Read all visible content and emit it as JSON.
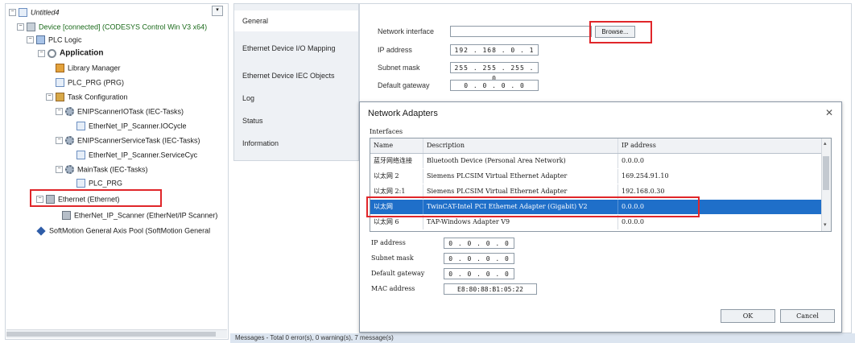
{
  "tree": {
    "items": [
      {
        "label": "Untitled4"
      },
      {
        "label": "Device [connected] (CODESYS Control Win V3 x64)"
      },
      {
        "label": "PLC Logic"
      },
      {
        "label": "Application"
      },
      {
        "label": "Library Manager"
      },
      {
        "label": "PLC_PRG (PRG)"
      },
      {
        "label": "Task Configuration"
      },
      {
        "label": "ENIPScannerIOTask (IEC-Tasks)"
      },
      {
        "label": "EtherNet_IP_Scanner.IOCycle"
      },
      {
        "label": "ENIPScannerServiceTask (IEC-Tasks)"
      },
      {
        "label": "EtherNet_IP_Scanner.ServiceCyc"
      },
      {
        "label": "MainTask (IEC-Tasks)"
      },
      {
        "label": "PLC_PRG"
      },
      {
        "label": "Ethernet (Ethernet)"
      },
      {
        "label": "EtherNet_IP_Scanner (EtherNet/IP Scanner)"
      },
      {
        "label": "SoftMotion General Axis Pool (SoftMotion General"
      }
    ]
  },
  "tabs": [
    {
      "label": "General"
    },
    {
      "label": "Ethernet Device I/O Mapping"
    },
    {
      "label": "Ethernet Device IEC Objects"
    },
    {
      "label": "Log"
    },
    {
      "label": "Status"
    },
    {
      "label": "Information"
    }
  ],
  "general": {
    "network_interface_label": "Network interface",
    "browse_label": "Browse...",
    "ip_label": "IP address",
    "ip_value": "192 . 168 . 0 . 1",
    "subnet_label": "Subnet mask",
    "subnet_value": "255 . 255 . 255 . 0",
    "gateway_label": "Default gateway",
    "gateway_value": "0 . 0 . 0 . 0"
  },
  "dialog": {
    "title": "Network Adapters",
    "interfaces_label": "Interfaces",
    "columns": [
      "Name",
      "Description",
      "IP address"
    ],
    "rows": [
      {
        "name": "蓝牙网络连接",
        "desc": "Bluetooth Device (Personal Area Network)",
        "ip": "0.0.0.0"
      },
      {
        "name": "以太网 2",
        "desc": "Siemens PLCSIM Virtual Ethernet Adapter",
        "ip": "169.254.91.10"
      },
      {
        "name": "以太网 2:1",
        "desc": "Siemens PLCSIM Virtual Ethernet Adapter",
        "ip": "192.168.0.30"
      },
      {
        "name": "以太网",
        "desc": "TwinCAT-Intel PCI Ethernet Adapter (Gigabit) V2",
        "ip": "0.0.0.0"
      },
      {
        "name": "以太网 6",
        "desc": "TAP-Windows Adapter V9",
        "ip": "0.0.0.0"
      }
    ],
    "selected_row": 3,
    "ip_label": "IP address",
    "ip_value": "0 . 0 . 0 . 0",
    "subnet_label": "Subnet mask",
    "subnet_value": "0 . 0 . 0 . 0",
    "gateway_label": "Default gateway",
    "gateway_value": "0 . 0 . 0 . 0",
    "mac_label": "MAC address",
    "mac_value": "E8:80:88:B1:05:22",
    "ok_label": "OK",
    "cancel_label": "Cancel"
  },
  "messages": {
    "text": "Messages - Total 0 error(s), 0 warning(s), 7 message(s)"
  },
  "colors": {
    "selection": "#1f6fc9",
    "highlight_box": "#e0262a"
  }
}
